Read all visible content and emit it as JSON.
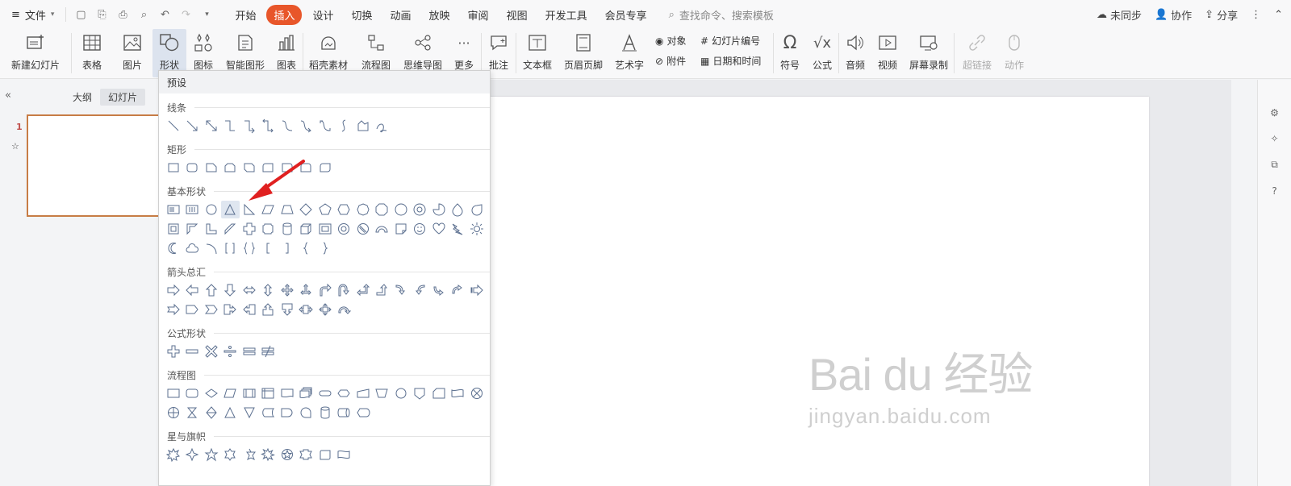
{
  "menubar": {
    "file_label": "文件",
    "tabs": [
      "开始",
      "插入",
      "设计",
      "切换",
      "动画",
      "放映",
      "审阅",
      "视图",
      "开发工具",
      "会员专享"
    ],
    "active_tab": "插入",
    "search_placeholder": "查找命令、搜索模板",
    "sync_label": "未同步",
    "collab_label": "协作",
    "share_label": "分享"
  },
  "ribbon": {
    "new_slide": "新建幻灯片",
    "table": "表格",
    "picture": "图片",
    "shape": "形状",
    "icon": "图标",
    "smartart": "智能图形",
    "chart": "图表",
    "material": "稻壳素材",
    "flowchart": "流程图",
    "mindmap": "思维导图",
    "more": "更多",
    "comment": "批注",
    "textbox": "文本框",
    "header_footer": "页眉页脚",
    "wordart": "艺术字",
    "object": "对象",
    "slide_number": "幻灯片编号",
    "attachment": "附件",
    "datetime": "日期和时间",
    "symbol": "符号",
    "formula": "公式",
    "audio": "音频",
    "video": "视频",
    "screen_record": "屏幕录制",
    "hyperlink": "超链接",
    "action": "动作"
  },
  "leftpanel": {
    "outline_tab": "大纲",
    "slides_tab": "幻灯片",
    "slide_number": "1"
  },
  "dropdown": {
    "header": "预设",
    "categories": {
      "lines": "线条",
      "rectangles": "矩形",
      "basic": "基本形状",
      "arrows": "箭头总汇",
      "equation": "公式形状",
      "flowchart": "流程图",
      "stars": "星与旗帜"
    }
  },
  "watermark": {
    "main": "Bai du 经验",
    "sub": "jingyan.baidu.com"
  },
  "colors": {
    "accent": "#e8562a",
    "shape_stroke": "#5b6f8f",
    "arrow": "#e02020"
  }
}
